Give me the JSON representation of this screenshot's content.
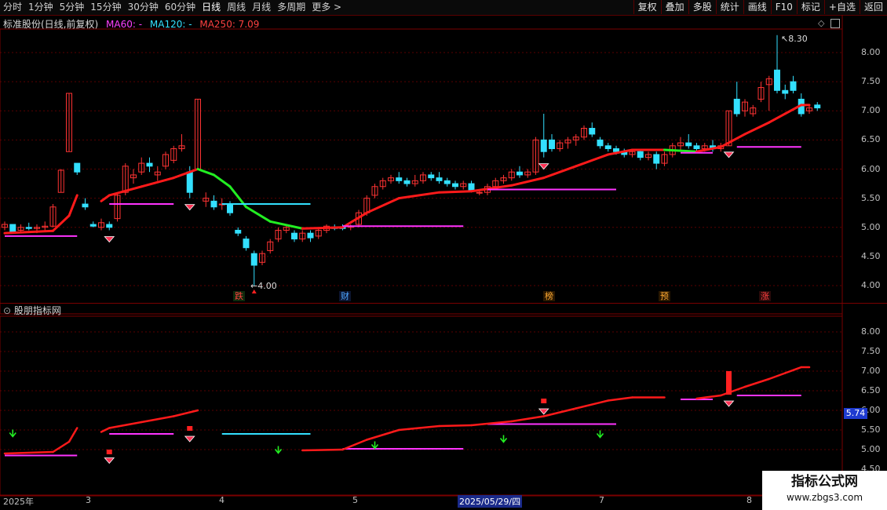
{
  "toolbar": {
    "left": [
      "分时",
      "1分钟",
      "5分钟",
      "15分钟",
      "30分钟",
      "60分钟",
      "日线",
      "周线",
      "月线",
      "多周期",
      "更多 >"
    ],
    "active": "日线",
    "right": [
      "复权",
      "叠加",
      "多股",
      "统计",
      "画线",
      "F10",
      "标记",
      "+自选",
      "返回"
    ]
  },
  "main_panel": {
    "title": "标准股份(日线,前复权)",
    "ma60": "MA60: -",
    "ma120": "MA120: -",
    "ma250": "MA250: 7.09",
    "y_ticks": [
      "8.00",
      "7.50",
      "7.00",
      "6.50",
      "6.00",
      "5.50",
      "5.00",
      "4.50",
      "4.00"
    ],
    "high_label": "8.30",
    "low_label": "4.00",
    "events": [
      {
        "text": "跌",
        "color": "#ff4040",
        "bg": "#0c2a0c"
      },
      {
        "text": "财",
        "color": "#4da6ff",
        "bg": "#0c1530"
      },
      {
        "text": "榜",
        "color": "#ffaa33",
        "bg": "#2a1800"
      },
      {
        "text": "预",
        "color": "#ffaa33",
        "bg": "#2a1800"
      },
      {
        "text": "涨",
        "color": "#ff4040",
        "bg": "#2a0a0a"
      }
    ]
  },
  "sub_panel": {
    "title": "股朋指标网",
    "y_ticks": [
      "8.00",
      "7.50",
      "7.00",
      "6.50",
      "6.00",
      "5.50",
      "5.00",
      "4.50"
    ],
    "price_tag": "5.74"
  },
  "dates": [
    "2025年",
    "3",
    "4",
    "5",
    "2025/05/29/四",
    "7",
    "8"
  ],
  "watermark": {
    "line1": "指标公式网",
    "line2": "www.zbgs3.com"
  },
  "chart_data": {
    "type": "candlestick",
    "y_range": [
      3.9,
      8.5
    ],
    "sub_y_range": [
      4.4,
      8.5
    ],
    "colors": {
      "up": "#ff3333",
      "down": "#33e0ff",
      "ma_rise": "#ff1a1a",
      "ma_fall": "#22ee22",
      "support": "#ff33ff",
      "line_cyan": "#33e0ff"
    },
    "candles": [
      [
        5.0,
        5.1,
        4.95,
        5.05
      ],
      [
        5.05,
        5.05,
        4.9,
        4.92
      ],
      [
        4.95,
        5.05,
        4.9,
        5.0
      ],
      [
        5.0,
        5.08,
        4.95,
        4.98
      ],
      [
        4.98,
        5.05,
        4.9,
        5.0
      ],
      [
        5.0,
        5.1,
        4.95,
        5.02
      ],
      [
        5.02,
        5.4,
        5.0,
        5.35
      ],
      [
        5.6,
        6.0,
        5.6,
        5.98
      ],
      [
        6.3,
        7.3,
        6.3,
        7.3
      ],
      [
        6.1,
        6.1,
        5.9,
        5.95
      ],
      [
        5.4,
        5.5,
        5.3,
        5.35
      ],
      [
        5.05,
        5.1,
        5.0,
        5.02
      ],
      [
        5.0,
        5.15,
        4.95,
        5.08
      ],
      [
        5.05,
        5.1,
        4.95,
        5.0
      ],
      [
        5.15,
        5.6,
        5.1,
        5.55
      ],
      [
        5.6,
        6.1,
        5.55,
        6.05
      ],
      [
        5.85,
        6.0,
        5.75,
        5.9
      ],
      [
        5.95,
        6.2,
        5.9,
        6.1
      ],
      [
        6.1,
        6.2,
        5.95,
        6.05
      ],
      [
        5.9,
        6.05,
        5.8,
        5.95
      ],
      [
        6.05,
        6.3,
        6.0,
        6.25
      ],
      [
        6.15,
        6.4,
        6.1,
        6.35
      ],
      [
        6.35,
        6.6,
        6.3,
        6.4
      ],
      [
        5.95,
        6.05,
        5.5,
        5.6
      ],
      [
        6.0,
        7.2,
        6.0,
        7.2
      ],
      [
        5.45,
        5.6,
        5.35,
        5.5
      ],
      [
        5.45,
        5.55,
        5.3,
        5.35
      ],
      [
        5.4,
        5.5,
        5.3,
        5.4
      ],
      [
        5.4,
        5.45,
        5.2,
        5.25
      ],
      [
        4.95,
        5.0,
        4.85,
        4.9
      ],
      [
        4.8,
        4.85,
        4.6,
        4.65
      ],
      [
        4.55,
        4.6,
        4.0,
        4.35
      ],
      [
        4.4,
        4.6,
        4.35,
        4.55
      ],
      [
        4.6,
        4.8,
        4.55,
        4.75
      ],
      [
        4.8,
        5.0,
        4.75,
        4.95
      ],
      [
        4.95,
        5.05,
        4.9,
        5.0
      ],
      [
        4.9,
        4.95,
        4.75,
        4.8
      ],
      [
        4.8,
        4.95,
        4.75,
        4.9
      ],
      [
        4.9,
        4.95,
        4.75,
        4.82
      ],
      [
        4.85,
        5.0,
        4.8,
        4.95
      ],
      [
        4.95,
        5.05,
        4.9,
        5.02
      ],
      [
        5.0,
        5.05,
        4.95,
        4.98
      ],
      [
        5.0,
        5.05,
        4.95,
        4.98
      ],
      [
        5.0,
        5.05,
        4.95,
        5.02
      ],
      [
        5.05,
        5.3,
        5.0,
        5.25
      ],
      [
        5.25,
        5.55,
        5.2,
        5.5
      ],
      [
        5.55,
        5.75,
        5.5,
        5.7
      ],
      [
        5.7,
        5.85,
        5.65,
        5.8
      ],
      [
        5.8,
        5.9,
        5.75,
        5.85
      ],
      [
        5.85,
        5.95,
        5.75,
        5.8
      ],
      [
        5.8,
        5.85,
        5.7,
        5.75
      ],
      [
        5.75,
        5.9,
        5.7,
        5.8
      ],
      [
        5.8,
        5.95,
        5.75,
        5.9
      ],
      [
        5.9,
        5.95,
        5.8,
        5.85
      ],
      [
        5.85,
        5.95,
        5.75,
        5.8
      ],
      [
        5.8,
        5.85,
        5.7,
        5.75
      ],
      [
        5.75,
        5.8,
        5.65,
        5.7
      ],
      [
        5.7,
        5.8,
        5.65,
        5.75
      ],
      [
        5.75,
        5.8,
        5.6,
        5.62
      ],
      [
        5.6,
        5.65,
        5.55,
        5.6
      ],
      [
        5.6,
        5.75,
        5.55,
        5.7
      ],
      [
        5.7,
        5.85,
        5.65,
        5.8
      ],
      [
        5.8,
        5.9,
        5.75,
        5.85
      ],
      [
        5.85,
        6.0,
        5.8,
        5.95
      ],
      [
        5.95,
        6.05,
        5.85,
        5.9
      ],
      [
        5.9,
        6.0,
        5.85,
        5.95
      ],
      [
        5.95,
        6.55,
        5.9,
        6.5
      ],
      [
        6.5,
        6.95,
        6.2,
        6.3
      ],
      [
        6.5,
        6.6,
        6.3,
        6.35
      ],
      [
        6.35,
        6.5,
        6.3,
        6.45
      ],
      [
        6.45,
        6.55,
        6.35,
        6.5
      ],
      [
        6.5,
        6.6,
        6.4,
        6.55
      ],
      [
        6.55,
        6.75,
        6.5,
        6.7
      ],
      [
        6.7,
        6.8,
        6.55,
        6.6
      ],
      [
        6.5,
        6.55,
        6.35,
        6.4
      ],
      [
        6.4,
        6.45,
        6.3,
        6.35
      ],
      [
        6.35,
        6.4,
        6.25,
        6.3
      ],
      [
        6.3,
        6.35,
        6.2,
        6.25
      ],
      [
        6.25,
        6.35,
        6.2,
        6.3
      ],
      [
        6.3,
        6.35,
        6.15,
        6.2
      ],
      [
        6.2,
        6.3,
        6.15,
        6.25
      ],
      [
        6.25,
        6.3,
        6.0,
        6.1
      ],
      [
        6.1,
        6.3,
        6.05,
        6.25
      ],
      [
        6.25,
        6.45,
        6.2,
        6.4
      ],
      [
        6.4,
        6.55,
        6.3,
        6.45
      ],
      [
        6.45,
        6.6,
        6.35,
        6.4
      ],
      [
        6.4,
        6.45,
        6.3,
        6.35
      ],
      [
        6.35,
        6.45,
        6.3,
        6.4
      ],
      [
        6.4,
        6.5,
        6.3,
        6.35
      ],
      [
        6.35,
        6.45,
        6.3,
        6.4
      ],
      [
        6.4,
        7.0,
        6.4,
        7.0
      ],
      [
        7.2,
        7.5,
        6.9,
        6.95
      ],
      [
        7.0,
        7.2,
        6.9,
        7.15
      ],
      [
        6.95,
        7.1,
        6.9,
        7.05
      ],
      [
        7.2,
        7.5,
        7.15,
        7.4
      ],
      [
        7.45,
        7.6,
        7.0,
        7.55
      ],
      [
        7.7,
        8.3,
        7.3,
        7.35
      ],
      [
        7.35,
        7.45,
        7.2,
        7.3
      ],
      [
        7.5,
        7.6,
        7.3,
        7.35
      ],
      [
        7.2,
        7.3,
        6.9,
        6.95
      ],
      [
        7.0,
        7.1,
        6.95,
        7.05
      ],
      [
        7.1,
        7.15,
        7.0,
        7.05
      ]
    ],
    "ma_line": [
      [
        0,
        4.9
      ],
      [
        6,
        4.94
      ],
      [
        8,
        5.2
      ],
      [
        9,
        5.55
      ],
      [
        12,
        5.45
      ],
      [
        13,
        5.55
      ],
      [
        17,
        5.7
      ],
      [
        21,
        5.85
      ],
      [
        24,
        6.0
      ],
      [
        26,
        5.9
      ],
      [
        28,
        5.7
      ],
      [
        30,
        5.35
      ],
      [
        33,
        5.1
      ],
      [
        37,
        4.98
      ],
      [
        42,
        5.0
      ],
      [
        45,
        5.25
      ],
      [
        49,
        5.5
      ],
      [
        54,
        5.6
      ],
      [
        58,
        5.62
      ],
      [
        63,
        5.72
      ],
      [
        67,
        5.85
      ],
      [
        71,
        6.05
      ],
      [
        75,
        6.25
      ],
      [
        78,
        6.33
      ],
      [
        82,
        6.33
      ],
      [
        86,
        6.3
      ],
      [
        89,
        6.38
      ],
      [
        92,
        6.6
      ],
      [
        95,
        6.8
      ],
      [
        97,
        6.95
      ],
      [
        99,
        7.1
      ],
      [
        100,
        7.1
      ]
    ]
  }
}
